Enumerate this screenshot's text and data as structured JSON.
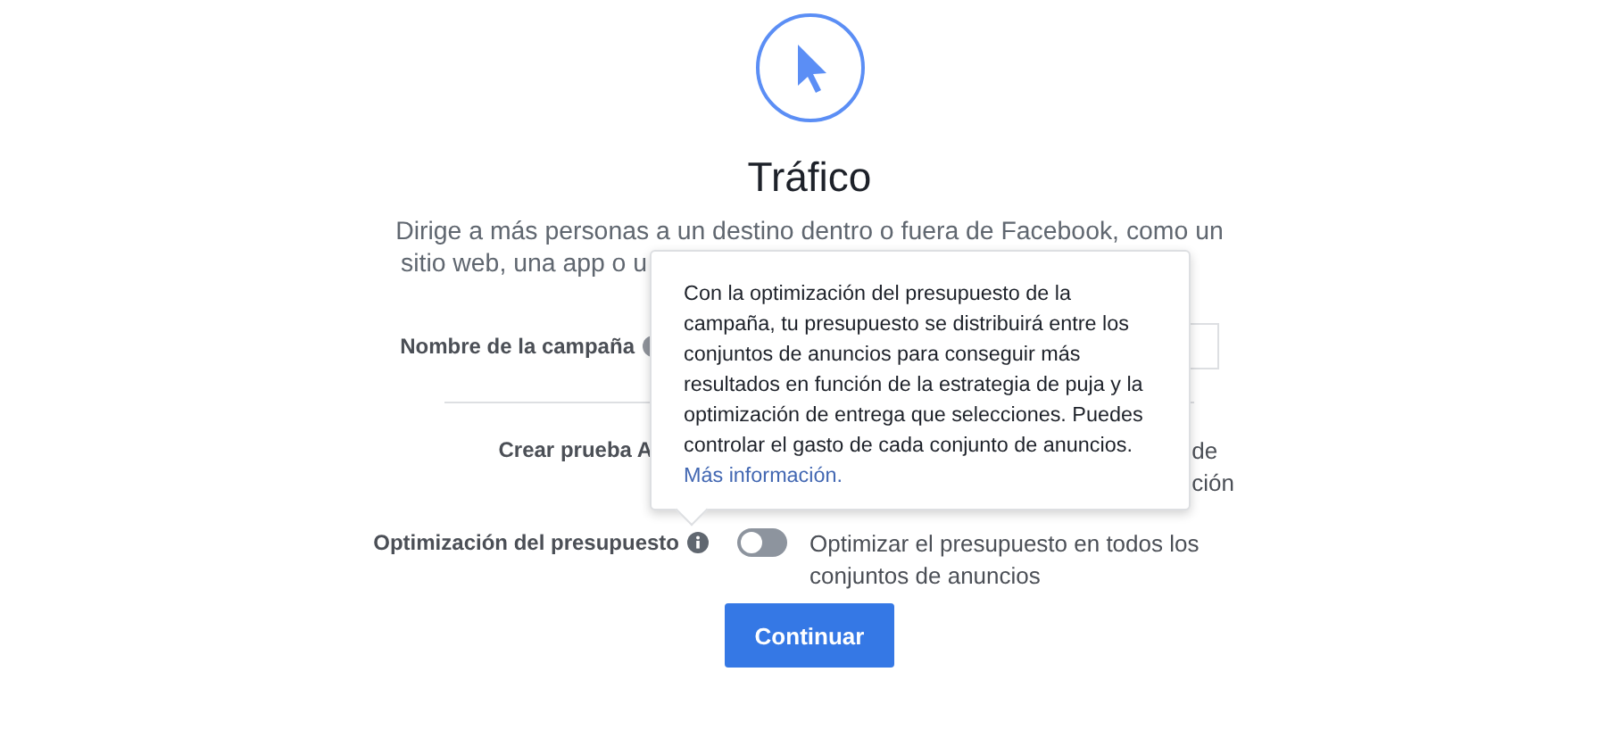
{
  "header": {
    "title": "Tráfico",
    "description_lines": [
      "Dirige a más personas a un destino dentro o fuera de Facebook, como un",
      "sitio web, una app o u"
    ]
  },
  "campaign_name": {
    "label": "Nombre de la campaña"
  },
  "ab_test": {
    "label": "Crear prueba A",
    "text_fragments": [
      "de",
      "ción"
    ]
  },
  "budget_optimization": {
    "label": "Optimización del presupuesto",
    "toggle": {
      "on": false,
      "label": "Optimizar el presupuesto en todos los conjuntos de anuncios"
    }
  },
  "tooltip": {
    "text": "Con la optimización del presupuesto de la campaña, tu presupuesto se distribuirá entre los conjuntos de anuncios para conseguir más resultados en función de la estrategia de puja y la optimización de entrega que selecciones. Puedes controlar el gasto de cada conjunto de anuncios.",
    "link": "Más información."
  },
  "continue_button": "Continuar"
}
